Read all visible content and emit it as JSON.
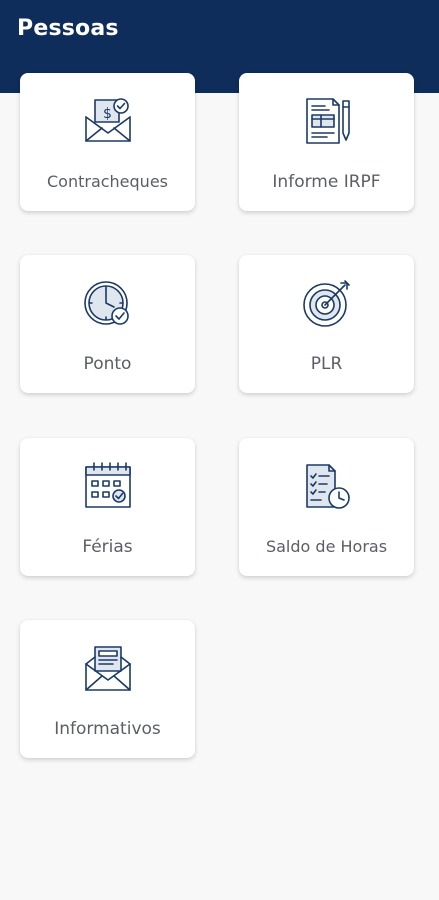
{
  "header": {
    "title": "Pessoas",
    "background": "#0f2d5a"
  },
  "cards": [
    {
      "label": "Contracheques",
      "icon": "payslip-envelope-icon"
    },
    {
      "label": "Informe IRPF",
      "icon": "document-pen-icon"
    },
    {
      "label": "Ponto",
      "icon": "clock-check-icon"
    },
    {
      "label": "PLR",
      "icon": "target-arrow-icon"
    },
    {
      "label": "Férias",
      "icon": "calendar-check-icon"
    },
    {
      "label": "Saldo de Horas",
      "icon": "checklist-clock-icon"
    },
    {
      "label": "Informativos",
      "icon": "newsletter-envelope-icon"
    }
  ],
  "colors": {
    "icon_stroke": "#1b3a66",
    "accent_fill": "#dfe6ee"
  }
}
